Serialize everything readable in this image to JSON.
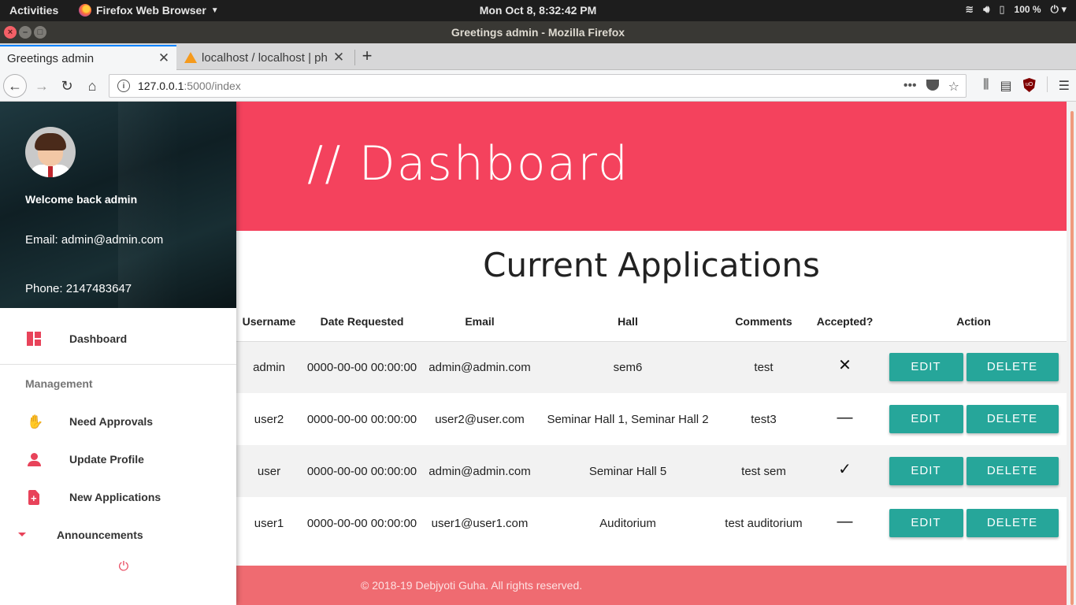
{
  "os": {
    "activities": "Activities",
    "app_name": "Firefox Web Browser",
    "clock": "Mon Oct  8,  8:32:42 PM",
    "battery": "100 %"
  },
  "window": {
    "title": "Greetings admin - Mozilla Firefox"
  },
  "tabs": [
    {
      "label": "Greetings admin"
    },
    {
      "label": "localhost / localhost | ph"
    }
  ],
  "url": {
    "host": "127.0.0.1",
    "path": ":5000/index"
  },
  "sidebar": {
    "welcome": "Welcome back admin",
    "email": "Email: admin@admin.com",
    "phone": "Phone: 2147483647",
    "dashboard": "Dashboard",
    "section": "Management",
    "items": [
      {
        "label": "Need Approvals"
      },
      {
        "label": "Update Profile"
      },
      {
        "label": "New Applications"
      },
      {
        "label": "Announcements"
      }
    ]
  },
  "banner": {
    "title": "// Dashboard"
  },
  "applications": {
    "title": "Current Applications",
    "headers": [
      "Username",
      "Date Requested",
      "Email",
      "Hall",
      "Comments",
      "Accepted?",
      "Action"
    ],
    "rows": [
      {
        "username": "admin",
        "date": "0000-00-00 00:00:00",
        "email": "admin@admin.com",
        "hall": "sem6",
        "comments": "test",
        "accepted": "✕"
      },
      {
        "username": "user2",
        "date": "0000-00-00 00:00:00",
        "email": "user2@user.com",
        "hall": "Seminar Hall 1, Seminar Hall 2",
        "comments": "test3",
        "accepted": "—"
      },
      {
        "username": "user",
        "date": "0000-00-00 00:00:00",
        "email": "admin@admin.com",
        "hall": "Seminar Hall 5",
        "comments": "test sem",
        "accepted": "✓"
      },
      {
        "username": "user1",
        "date": "0000-00-00 00:00:00",
        "email": "user1@user1.com",
        "hall": "Auditorium",
        "comments": "test auditorium",
        "accepted": "—"
      }
    ],
    "edit_label": "EDIT",
    "delete_label": "DELETE"
  },
  "footer": {
    "text": "© 2018-19 Debjyoti Guha. All rights reserved."
  },
  "colors": {
    "banner": "#f4425d",
    "accent": "#e8435a",
    "button": "#26a69a",
    "footer": "#ef6b71"
  }
}
